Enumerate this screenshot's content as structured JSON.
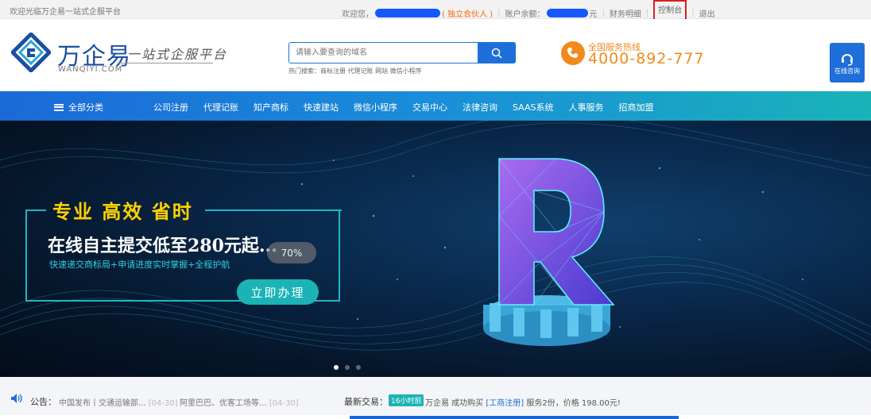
{
  "topbar": {
    "welcome": "欢迎光临万企易一站式企服平台",
    "greeting": "欢迎您，",
    "partner": "( 独立合伙人 )",
    "balance_label": "账户余额：",
    "currency": "元",
    "finance": "财务明细",
    "console": "控制台",
    "logout": "退出"
  },
  "header": {
    "logo_text": "万企易",
    "logo_sub": "WANQIYI.COM",
    "slogan": "一站式企服平台",
    "search_placeholder": "请输入要查询的域名",
    "hot_search": "热门搜索：商标注册 代理记账 网站 微信小程序",
    "hotline_label": "全国服务热线",
    "hotline_number": "4000-892-777",
    "online_consult": "在线咨询"
  },
  "nav": {
    "all_categories": "全部分类",
    "items": [
      "公司注册",
      "代理记账",
      "知产商标",
      "快速建站",
      "微信小程序",
      "交易中心",
      "法律咨询",
      "SAAS系统",
      "人事服务",
      "招商加盟"
    ]
  },
  "banner": {
    "title": "专业 高效 省时",
    "subtitle": "在线自主提交低至280元起...",
    "description": "快速递交商标局+申请进度实时掌握+全程护航",
    "badge": "70%",
    "button": "立即办理"
  },
  "notice": {
    "label": "公告：",
    "items": [
      {
        "text": "中国发布丨交通运输部...",
        "date": "[04-30]"
      },
      {
        "text": "阿里巴巴、优客工场等...",
        "date": "[04-30]"
      }
    ],
    "trade_label": "最新交易：",
    "trade_badge": "16小时前",
    "trade_prefix": "万企易 成功购买",
    "trade_tag": "[工商注册]",
    "trade_suffix": "服务2份，价格 198.00元!"
  },
  "colors": {
    "brand_blue": "#1e6fd9",
    "accent_orange": "#f08a1d",
    "teal": "#1bb3b5",
    "highlight_red": "#e01c1c"
  }
}
